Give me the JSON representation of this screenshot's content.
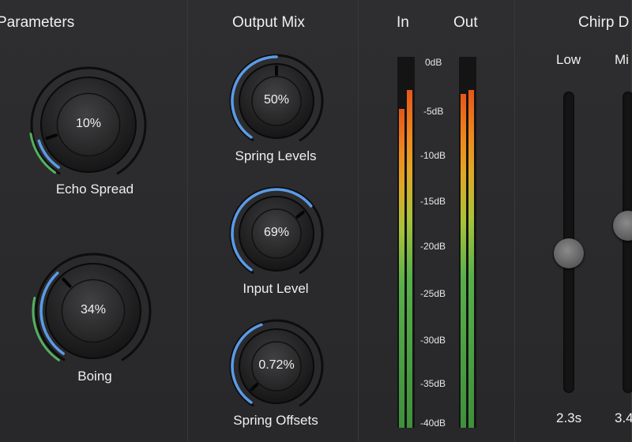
{
  "parameters_panel": {
    "title": "Parameters",
    "knobs": [
      {
        "label": "Echo Spread",
        "value": "10%",
        "level": 0.1
      },
      {
        "label": "Boing",
        "value": "34%",
        "level": 0.34
      }
    ]
  },
  "output_mix_panel": {
    "title": "Output Mix",
    "knobs": [
      {
        "label": "Spring Levels",
        "value": "50%",
        "level": 0.5
      },
      {
        "label": "Input Level",
        "value": "69%",
        "level": 0.69
      },
      {
        "label": "Spring Offsets",
        "value": "0.72%",
        "level": 0.0072
      }
    ]
  },
  "meters_panel": {
    "in_label": "In",
    "out_label": "Out",
    "scale": [
      "0dB",
      "-5dB",
      "-10dB",
      "-15dB",
      "-20dB",
      "-25dB",
      "-30dB",
      "-35dB",
      "-40dB"
    ],
    "in_levels": [
      0.86,
      0.91
    ],
    "out_levels": [
      0.9,
      0.91
    ]
  },
  "chirp_panel": {
    "title": "Chirp D",
    "sliders": [
      {
        "label": "Low",
        "value": "2.3s",
        "level": 0.46
      },
      {
        "label": "Mi",
        "value": "3.4",
        "level": 0.56
      }
    ]
  },
  "colors": {
    "accent_blue": "#5b9be8",
    "accent_green": "#55b060",
    "background": "#2b2b2d"
  },
  "icons": {
    "knob": "rotary-knob-icon"
  }
}
